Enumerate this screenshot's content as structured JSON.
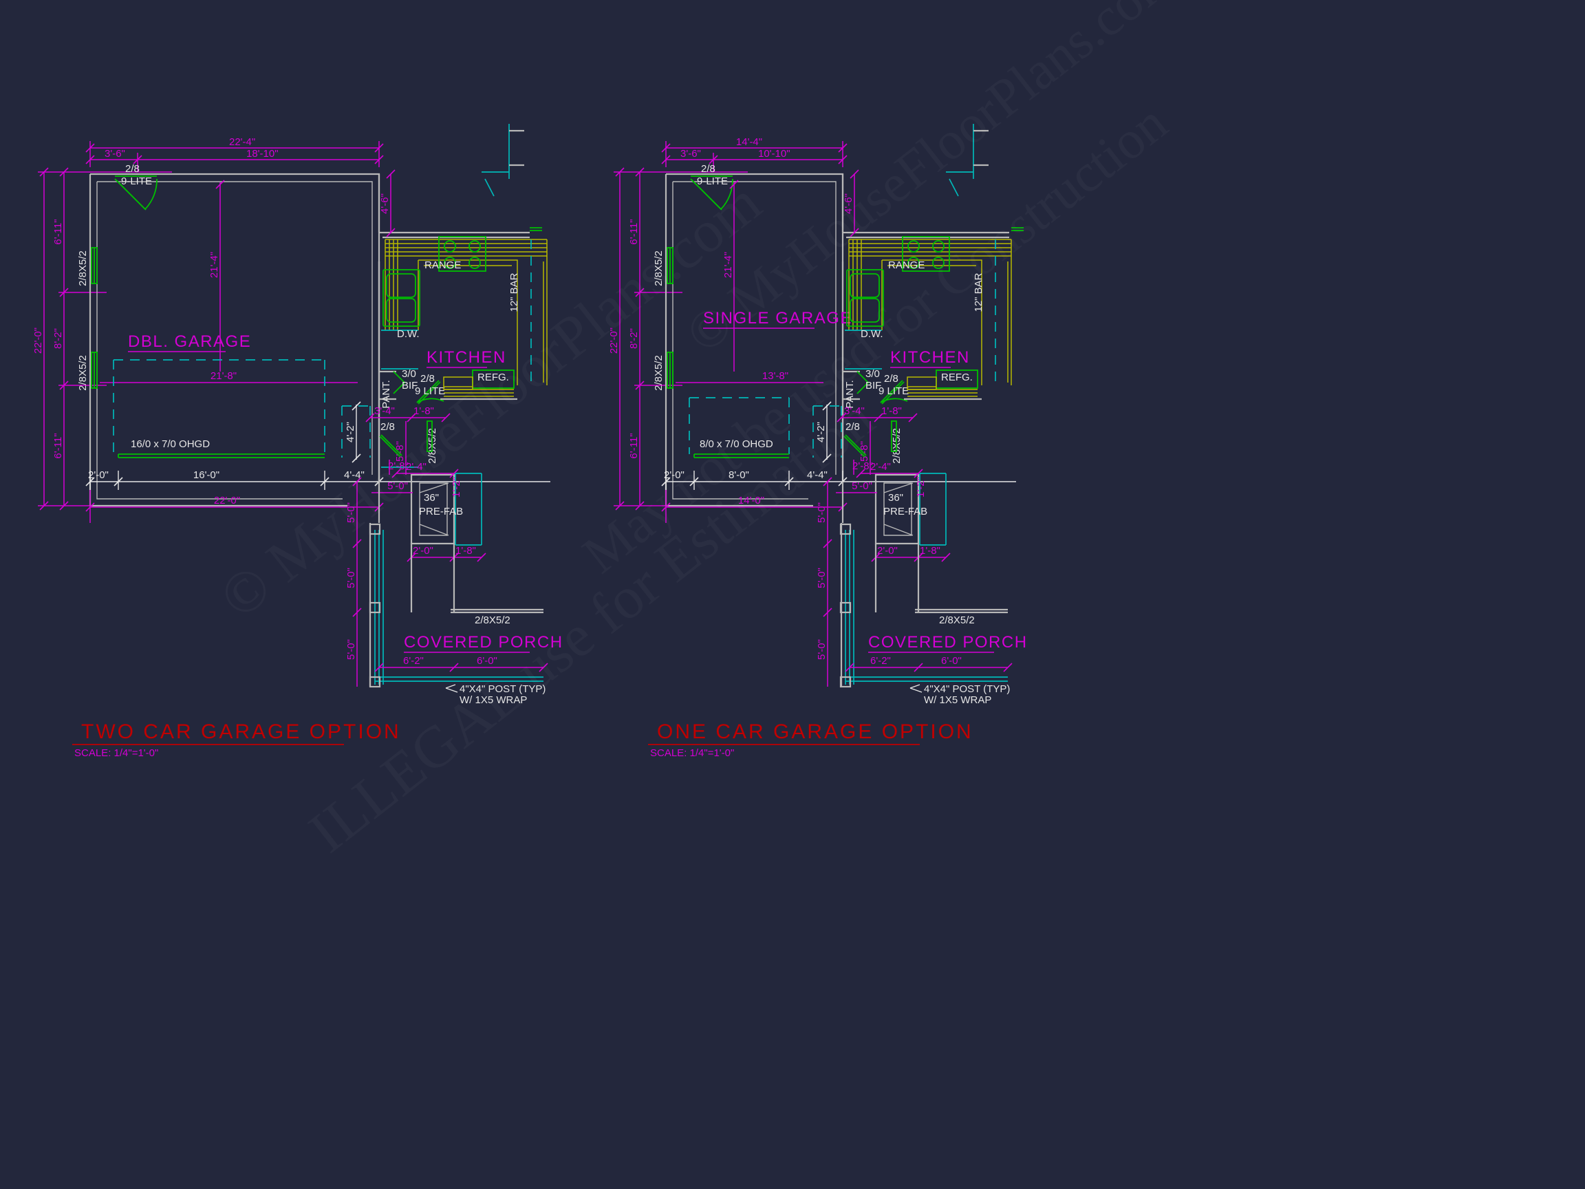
{
  "sheet": {
    "background_color": "#23273c",
    "colors": {
      "dim_magenta": "#d400d4",
      "wall_white": "#b8b8b8",
      "door_green": "#00c000",
      "cabinet_yellow": "#b8b800",
      "cyan": "#00b8b8",
      "title_red": "#c00000",
      "text_white": "#e6e6e6"
    },
    "watermarks": [
      "© MyHouseFloorPlans.com",
      "ILLEGAL use for Estimation",
      "May not be used for Construction"
    ]
  },
  "plans": [
    {
      "id": "two-car",
      "title": "TWO  CAR  GARAGE  OPTION",
      "scale": "SCALE: 1/4\"=1'-0\"",
      "rooms": {
        "garage": "DBL. GARAGE",
        "kitchen": "KITCHEN",
        "porch": "COVERED PORCH",
        "pantry": "PANT."
      },
      "fixtures": {
        "range": "RANGE",
        "dishwasher": "D.W.",
        "refrigerator": "REFG.",
        "bar": "12\" BAR",
        "fireplace_size": "36\"",
        "fireplace_type": "PRE-FAB"
      },
      "doors": {
        "entry_size": "2/8",
        "entry_type": "9-LITE",
        "pantry_size": "3/0",
        "pantry_type": "BIF",
        "kitchen_size": "2/8",
        "kitchen_type": "9 LITE",
        "service_size": "2/8",
        "overhead": "16/0 x 7/0 OHGD"
      },
      "windows": {
        "left_upper": "2/8X5/2",
        "left_lower": "2/8X5/2",
        "side": "2/8X5/2",
        "porch": "2/8X5/2"
      },
      "dimensions": {
        "top_overall": "22'-4\"",
        "top_seg_a": "3'-6\"",
        "top_seg_b": "18'-10\"",
        "left_overall": "22'-0\"",
        "left_seg_a": "6'-11\"",
        "left_seg_b": "8'-2\"",
        "left_seg_c": "6'-11\"",
        "inner_vert": "21'-4\"",
        "inner_horz": "21'-8\"",
        "bottom_a": "2'-0\"",
        "bottom_b": "16'-0\"",
        "bottom_c": "4'-4\"",
        "bottom_overall": "22'-0\"",
        "right_top": "4'-6\"",
        "slab_depth": "4'-2\"",
        "kitch_a": "3'-4\"",
        "kitch_b": "1'-8\"",
        "kitch_c": "2'-8\"",
        "kitch_d": "5'-8\"",
        "fire_a": "2'-4\"",
        "fire_b": "5'-0\"",
        "fire_c": "2'-0\"",
        "fire_d": "1'-8\"",
        "fire_e": "1'-2\"",
        "porch_v1": "5'-0\"",
        "porch_v2": "5'-0\"",
        "porch_v3": "5'-0\"",
        "porch_b1": "6'-2\"",
        "porch_b2": "6'-0\""
      },
      "notes": {
        "post_line1": "4\"X4\" POST (TYP)",
        "post_line2": "W/ 1X5 WRAP"
      }
    },
    {
      "id": "one-car",
      "title": "ONE  CAR  GARAGE  OPTION",
      "scale": "SCALE: 1/4\"=1'-0\"",
      "rooms": {
        "garage": "SINGLE GARAGE",
        "kitchen": "KITCHEN",
        "porch": "COVERED PORCH",
        "pantry": "PANT."
      },
      "fixtures": {
        "range": "RANGE",
        "dishwasher": "D.W.",
        "refrigerator": "REFG.",
        "bar": "12\" BAR",
        "fireplace_size": "36\"",
        "fireplace_type": "PRE-FAB"
      },
      "doors": {
        "entry_size": "2/8",
        "entry_type": "9-LITE",
        "pantry_size": "3/0",
        "pantry_type": "BIF",
        "kitchen_size": "2/8",
        "kitchen_type": "9 LITE",
        "service_size": "2/8",
        "overhead": "8/0 x 7/0 OHGD"
      },
      "windows": {
        "left_upper": "2/8X5/2",
        "left_lower": "2/8X5/2",
        "side": "2/8X5/2",
        "porch": "2/8X5/2"
      },
      "dimensions": {
        "top_overall": "14'-4\"",
        "top_seg_a": "3'-6\"",
        "top_seg_b": "10'-10\"",
        "left_overall": "22'-0\"",
        "left_seg_a": "6'-11\"",
        "left_seg_b": "8'-2\"",
        "left_seg_c": "6'-11\"",
        "inner_vert": "21'-4\"",
        "inner_horz": "13'-8\"",
        "bottom_a": "2'-0\"",
        "bottom_b": "8'-0\"",
        "bottom_c": "4'-4\"",
        "bottom_overall": "14'-0\"",
        "right_top": "4'-6\"",
        "slab_depth": "4'-2\"",
        "kitch_a": "3'-4\"",
        "kitch_b": "1'-8\"",
        "kitch_c": "2'-8\"",
        "kitch_d": "5'-8\"",
        "fire_a": "2'-4\"",
        "fire_b": "5'-0\"",
        "fire_c": "2'-0\"",
        "fire_d": "1'-8\"",
        "fire_e": "1'-2\"",
        "porch_v1": "5'-0\"",
        "porch_v2": "5'-0\"",
        "porch_v3": "5'-0\"",
        "porch_b1": "6'-2\"",
        "porch_b2": "6'-0\""
      },
      "notes": {
        "post_line1": "4\"X4\" POST (TYP)",
        "post_line2": "W/ 1X5 WRAP"
      }
    }
  ]
}
